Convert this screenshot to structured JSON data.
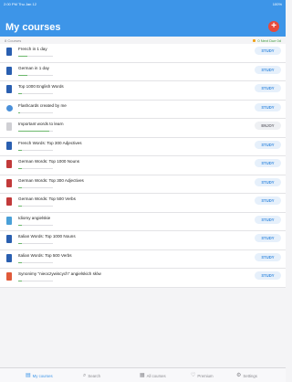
{
  "status": {
    "time": "2:00 PM",
    "date": "Thu Jan 12",
    "battery": "100%"
  },
  "header": {
    "title": "My courses",
    "add_label": "+"
  },
  "sub": {
    "left": "8 Courses",
    "right": "0 Next Due 0d"
  },
  "courses": [
    {
      "title": "French in 1 day",
      "action": "STUDY",
      "icon_color": "#2a5fb0",
      "icon_shape": "book",
      "progress": 0.25
    },
    {
      "title": "German in 1 day",
      "action": "STUDY",
      "icon_color": "#2a5fb0",
      "icon_shape": "book",
      "progress": 0.25
    },
    {
      "title": "Top 1000 English Words",
      "action": "STUDY",
      "icon_color": "#2a5fb0",
      "icon_shape": "book",
      "progress": 0.1
    },
    {
      "title": "Flashcards created by me",
      "action": "STUDY",
      "icon_color": "#4a90d9",
      "icon_shape": "circle",
      "progress": 0.05
    },
    {
      "title": "Important words to learn",
      "action": "ENJOY",
      "icon_color": "#d0d0d4",
      "icon_shape": "book",
      "progress": 0.9
    },
    {
      "title": "French Words: Top 300 Adjectives",
      "action": "STUDY",
      "icon_color": "#2a5fb0",
      "icon_shape": "book",
      "progress": 0.1
    },
    {
      "title": "German Words: Top 1000 Nouns",
      "action": "STUDY",
      "icon_color": "#c23a3a",
      "icon_shape": "book",
      "progress": 0.1
    },
    {
      "title": "German Words: Top 300 Adjectives",
      "action": "STUDY",
      "icon_color": "#c23a3a",
      "icon_shape": "book",
      "progress": 0.1
    },
    {
      "title": "German Words: Top 500 Verbs",
      "action": "STUDY",
      "icon_color": "#c23a3a",
      "icon_shape": "book",
      "progress": 0.1
    },
    {
      "title": "Idiomy angielskie",
      "action": "STUDY",
      "icon_color": "#4aa0d8",
      "icon_shape": "book",
      "progress": 0.1
    },
    {
      "title": "Italian Words: Top 1000 Nouns",
      "action": "STUDY",
      "icon_color": "#2a5fb0",
      "icon_shape": "book",
      "progress": 0.1
    },
    {
      "title": "Italian Words: Top 500 Verbs",
      "action": "STUDY",
      "icon_color": "#2a5fb0",
      "icon_shape": "book",
      "progress": 0.1
    },
    {
      "title": "Synonimy \"nieoczywiscych\" angielskich słów",
      "action": "STUDY",
      "icon_color": "#e05a3a",
      "icon_shape": "book",
      "progress": 0.1
    }
  ],
  "tabs": [
    {
      "label": "My courses",
      "icon": "book-icon",
      "glyph": "▤",
      "active": true
    },
    {
      "label": "Search",
      "icon": "search-icon",
      "glyph": "⌕",
      "active": false
    },
    {
      "label": "All courses",
      "icon": "grid-icon",
      "glyph": "▦",
      "active": false
    },
    {
      "label": "Premium",
      "icon": "heart-icon",
      "glyph": "♡",
      "active": false
    },
    {
      "label": "Settings",
      "icon": "gear-icon",
      "glyph": "⚙",
      "active": false
    }
  ],
  "colors": {
    "header": "#3d95e8",
    "add": "#e64a3c",
    "study": "#3d8ee0"
  }
}
